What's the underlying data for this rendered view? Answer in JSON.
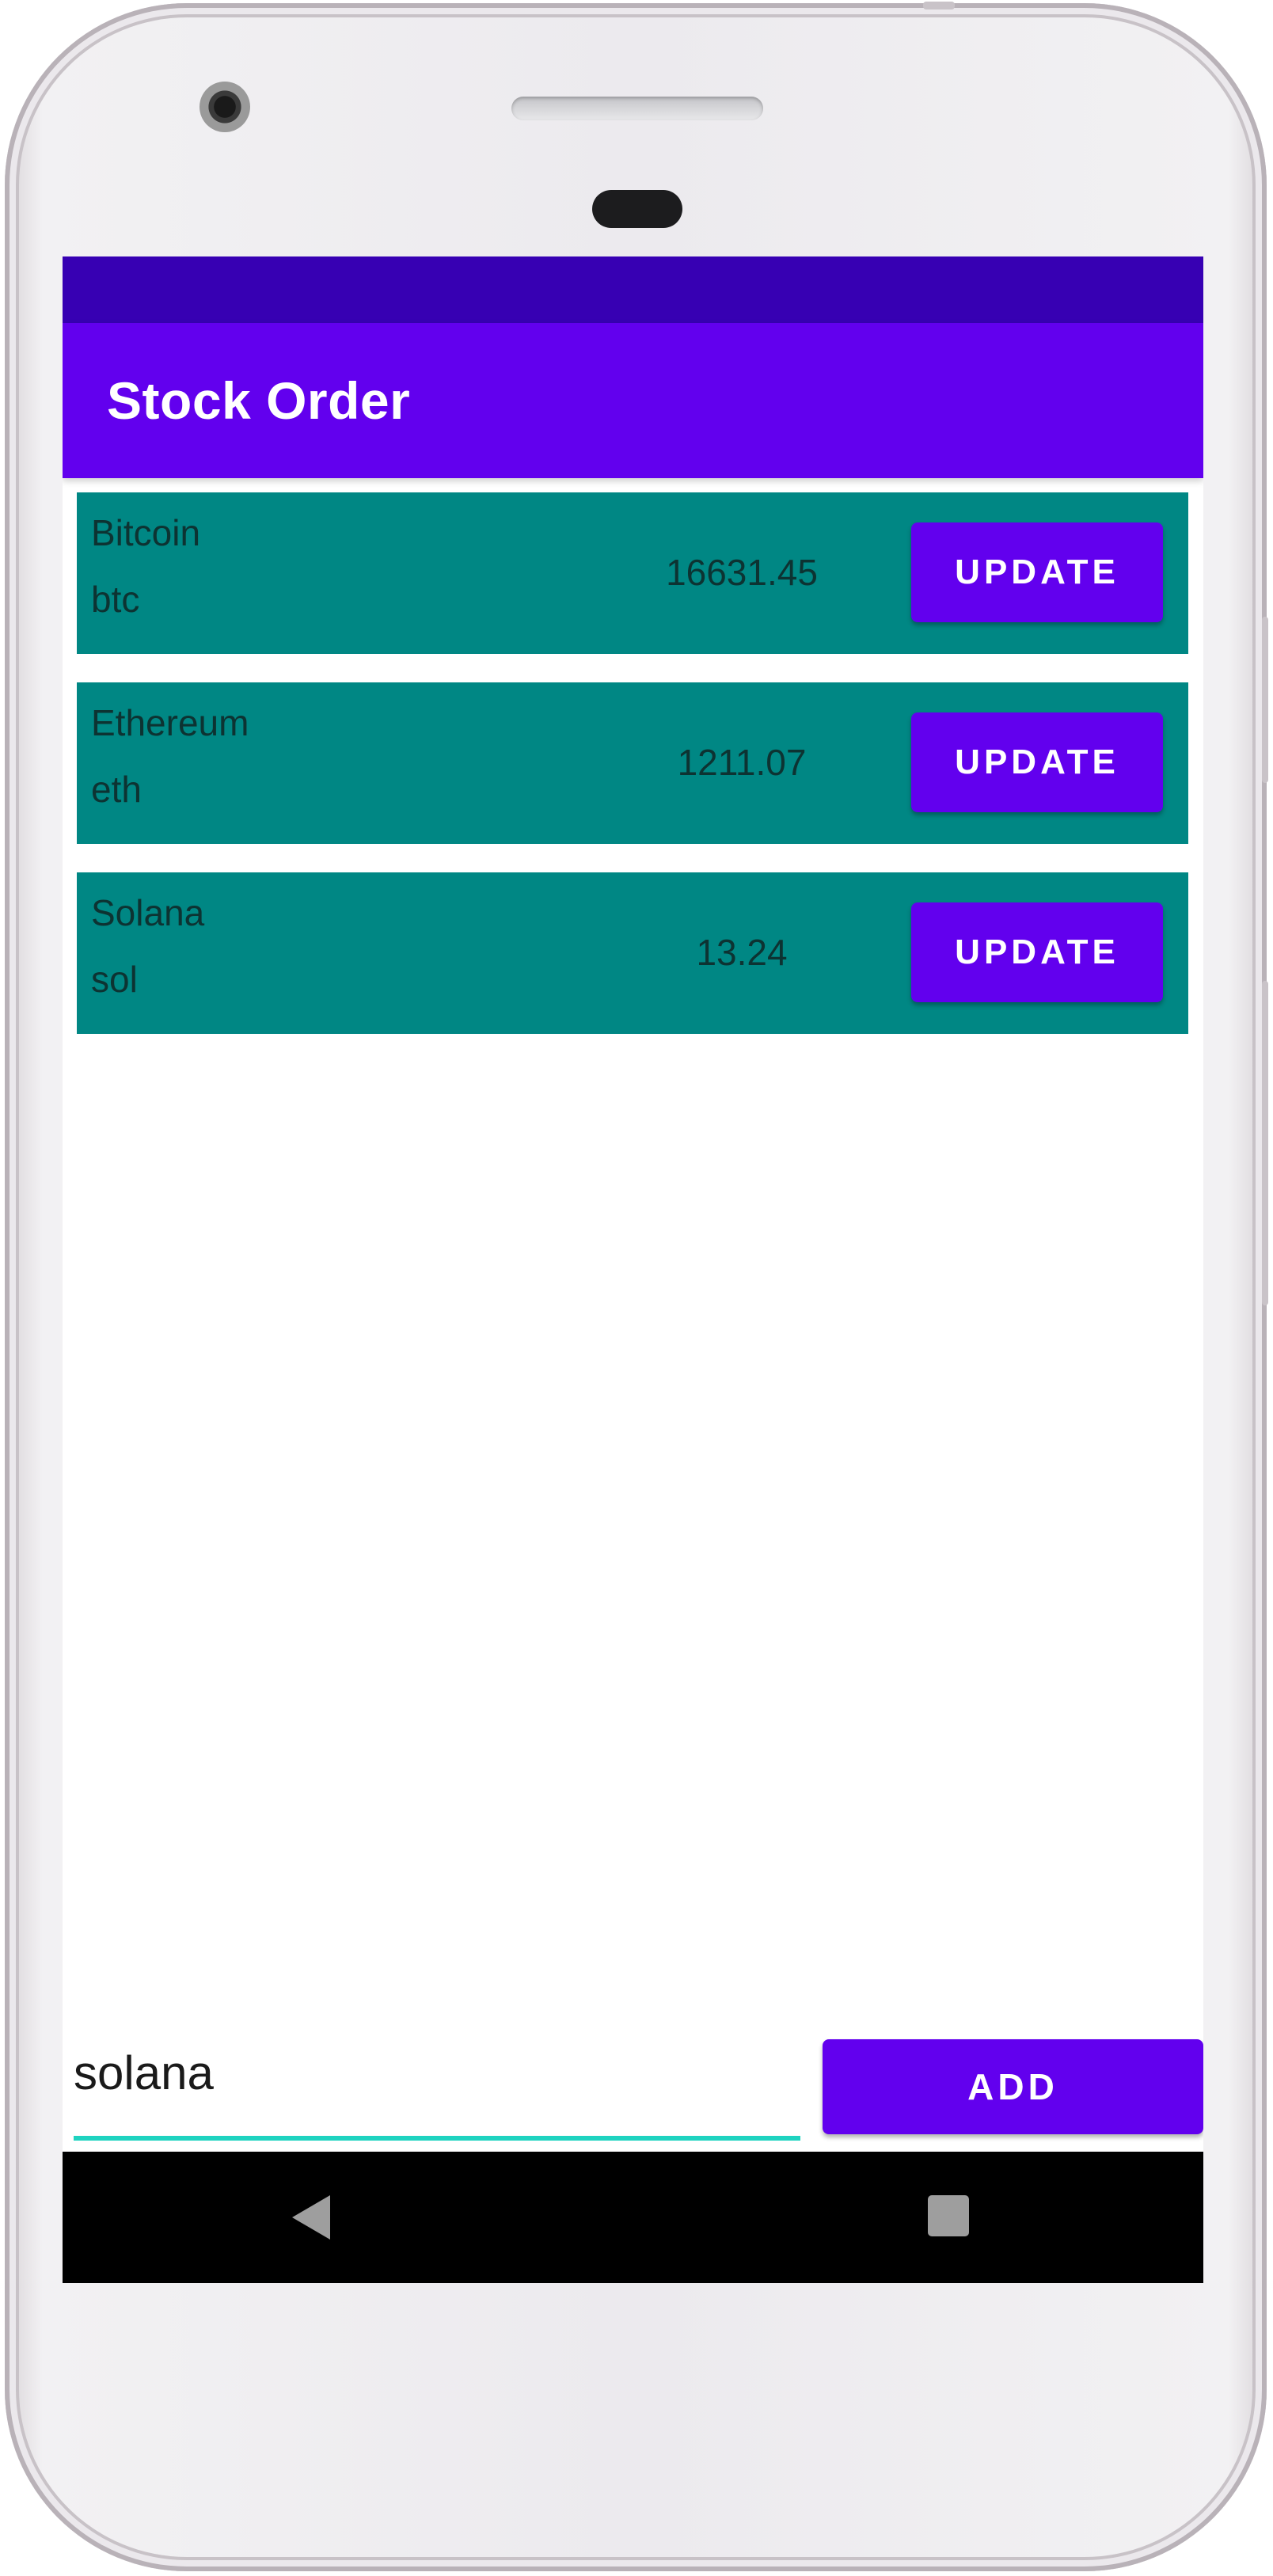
{
  "app_bar": {
    "title": "Stock Order"
  },
  "stocks": [
    {
      "name": "Bitcoin",
      "symbol": "btc",
      "price": "16631.45",
      "button_label": "UPDATE"
    },
    {
      "name": "Ethereum",
      "symbol": "eth",
      "price": "1211.07",
      "button_label": "UPDATE"
    },
    {
      "name": "Solana",
      "symbol": "sol",
      "price": "13.24",
      "button_label": "UPDATE"
    }
  ],
  "input": {
    "value": "solana"
  },
  "add_button": {
    "label": "ADD"
  },
  "nav": {
    "back_icon": "back-triangle",
    "recents_icon": "recents-square"
  },
  "colors": {
    "status_bar": "#3700b3",
    "primary": "#6200ee",
    "row_background": "#008784",
    "input_underline": "#1fd3c0",
    "nav_bar": "#000000"
  }
}
